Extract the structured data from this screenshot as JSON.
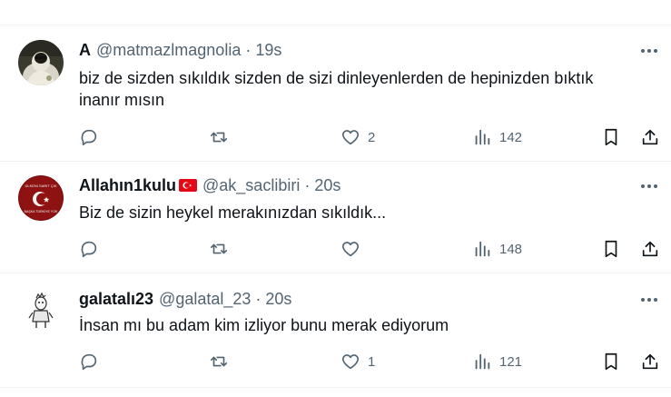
{
  "tweets": [
    {
      "name": "A",
      "handle": "@matmazlmagnolia",
      "dot": "·",
      "time": "19s",
      "text_lines": [
        "biz de sizden sıkıldık sizden de sizi dinleyenlerden de hepinizden bıktık",
        "inanır mısın"
      ],
      "reply_count": "",
      "retweet_count": "",
      "like_count": "2",
      "view_count": "142",
      "avatar_icon": "profile-photo-icon"
    },
    {
      "name": "Allahın1kulu",
      "flag_icon": "turkish-flag-icon",
      "handle": "@ak_saclibiri",
      "dot": "·",
      "time": "20s",
      "text_lines": [
        "Biz de sizin heykel merakınızdan sıkıldık..."
      ],
      "reply_count": "",
      "retweet_count": "",
      "like_count": "",
      "view_count": "148",
      "avatar_icon": "crescent-emblem-icon",
      "avatar_text": [
        "ÜLKENİ SARIT ÇIK",
        "BAŞKA TÜRKİYE YOK"
      ]
    },
    {
      "name": "galatalı23",
      "handle": "@galatal_23",
      "dot": "·",
      "time": "20s",
      "text_lines": [
        "İnsan mı bu adam kim izliyor bunu merak ediyorum"
      ],
      "reply_count": "",
      "retweet_count": "",
      "like_count": "1",
      "view_count": "121",
      "avatar_icon": "cartoon-figure-icon"
    }
  ],
  "colors": {
    "text": "#0f1419",
    "secondary": "#536471",
    "separator": "#eff3f4",
    "flag_red": "#e30a17"
  },
  "icons": [
    "reply-icon",
    "retweet-icon",
    "like-icon",
    "views-icon",
    "bookmark-icon",
    "share-icon",
    "more-icon"
  ]
}
